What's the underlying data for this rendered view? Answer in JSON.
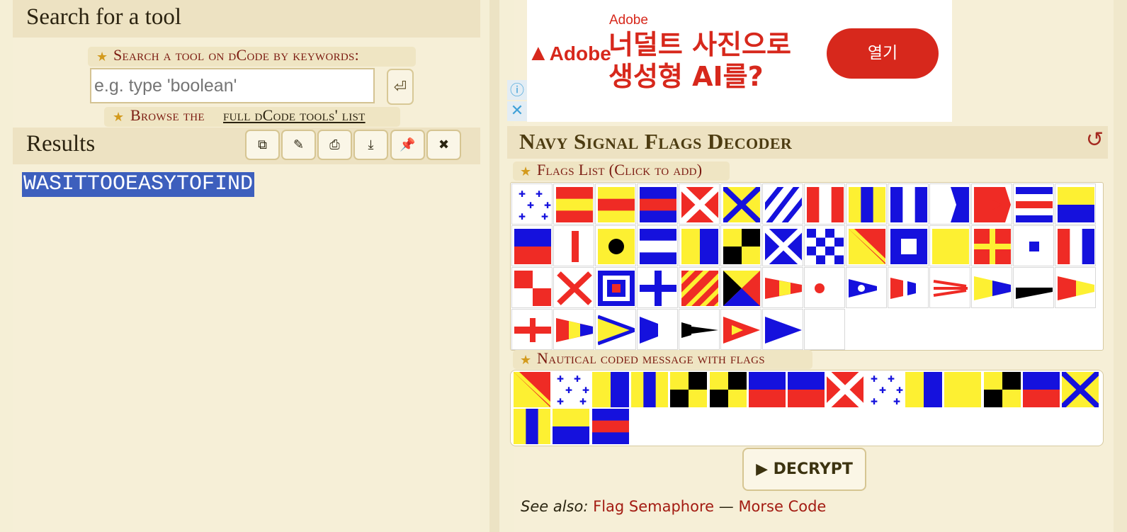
{
  "search": {
    "header": "Search for a tool",
    "keywords_label": "Search a tool on dCode by keywords:",
    "placeholder": "e.g. type 'boolean'",
    "go_icon": "⏎",
    "browse_prefix": "Browse the",
    "browse_link": "full dCode tools' list"
  },
  "results": {
    "header": "Results",
    "toolbar": [
      {
        "name": "copy-icon",
        "glyph": "⧉"
      },
      {
        "name": "edit-icon",
        "glyph": "✎"
      },
      {
        "name": "print-icon",
        "glyph": "⎙"
      },
      {
        "name": "download-icon",
        "glyph": "⤓"
      },
      {
        "name": "pin-icon",
        "glyph": "📌"
      },
      {
        "name": "close-icon",
        "glyph": "✖"
      }
    ],
    "output": "WASITTOOEASYTOFIND"
  },
  "ad": {
    "brand": "Adobe",
    "logo": "Adobe",
    "headline_line1": "너덜트 사진으로",
    "headline_line2": "생성형 AI를?",
    "button": "열기",
    "info_icon": "ⓘ",
    "close_icon": "✕"
  },
  "tool": {
    "title": "Navy Signal Flags Decoder",
    "refresh_icon": "↺",
    "flags_list_label": "Flags List (Click to add)",
    "message_label": "Nautical coded message with flags",
    "decrypt_button": "DECRYPT",
    "decrypt_icon": "▶",
    "see_also_label": "See also:",
    "see_also_links": [
      "Flag Semaphore",
      "Morse Code"
    ],
    "see_also_sep": "—"
  },
  "colors": {
    "red": "#ef2b25",
    "yellow": "#fdf032",
    "blue": "#1511dd",
    "black": "#000000",
    "white": "#ffffff"
  },
  "flags_list": [
    "A",
    "B",
    "C",
    "D",
    "E",
    "F",
    "G",
    "H",
    "I",
    "J",
    "K",
    "L",
    "M",
    "N",
    "O",
    "P",
    "Q",
    "R",
    "S",
    "T",
    "U",
    "V",
    "W",
    "X",
    "Y",
    "Z",
    "0",
    "1",
    "2",
    "3",
    "4",
    "5",
    "6",
    "7",
    "8",
    "9",
    "P0",
    "P1",
    "P2",
    "P3",
    "P4",
    "P5",
    "P6",
    "P7",
    "P8",
    "P9",
    "SUB1",
    "SUB2",
    "SUB3",
    "ANS"
  ],
  "message_flags": [
    "W",
    "A",
    "S",
    "I",
    "T",
    "T",
    "O",
    "O",
    "E",
    "A",
    "S",
    "Y",
    "T",
    "O",
    "F",
    "I",
    "N",
    "D"
  ]
}
